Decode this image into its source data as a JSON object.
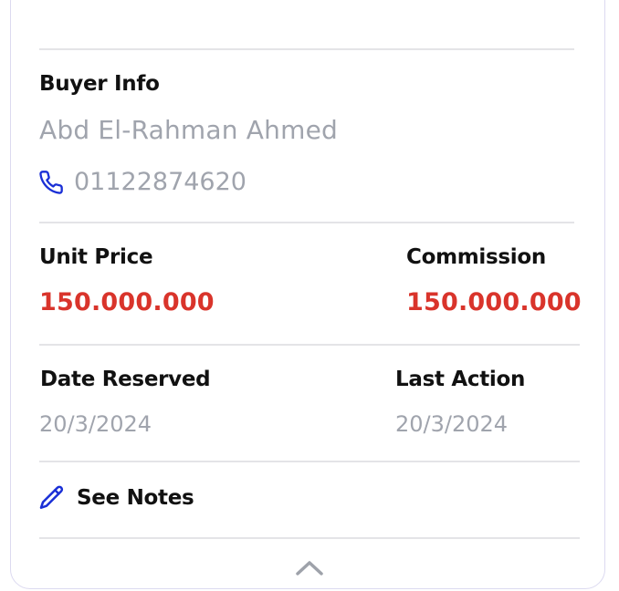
{
  "buyer": {
    "heading": "Buyer Info",
    "name": "Abd El-Rahman Ahmed",
    "phone": "01122874620"
  },
  "pricing": {
    "unit_price_label": "Unit Price",
    "unit_price_value": "150.000.000",
    "commission_label": "Commission",
    "commission_value": "150.000.000"
  },
  "dates": {
    "reserved_label": "Date Reserved",
    "reserved_value": "20/3/2024",
    "last_action_label": "Last Action",
    "last_action_value": "20/3/2024"
  },
  "notes": {
    "label": "See Notes"
  },
  "colors": {
    "accent_icon": "#1a2fd6",
    "price_red": "#d9342b",
    "muted_text": "#a0a4ad",
    "divider": "#e4e4e7"
  },
  "icons": {
    "top_partial": "circle-icon",
    "phone": "phone-icon",
    "notes": "pencil-icon",
    "collapse": "chevron-up-icon"
  }
}
